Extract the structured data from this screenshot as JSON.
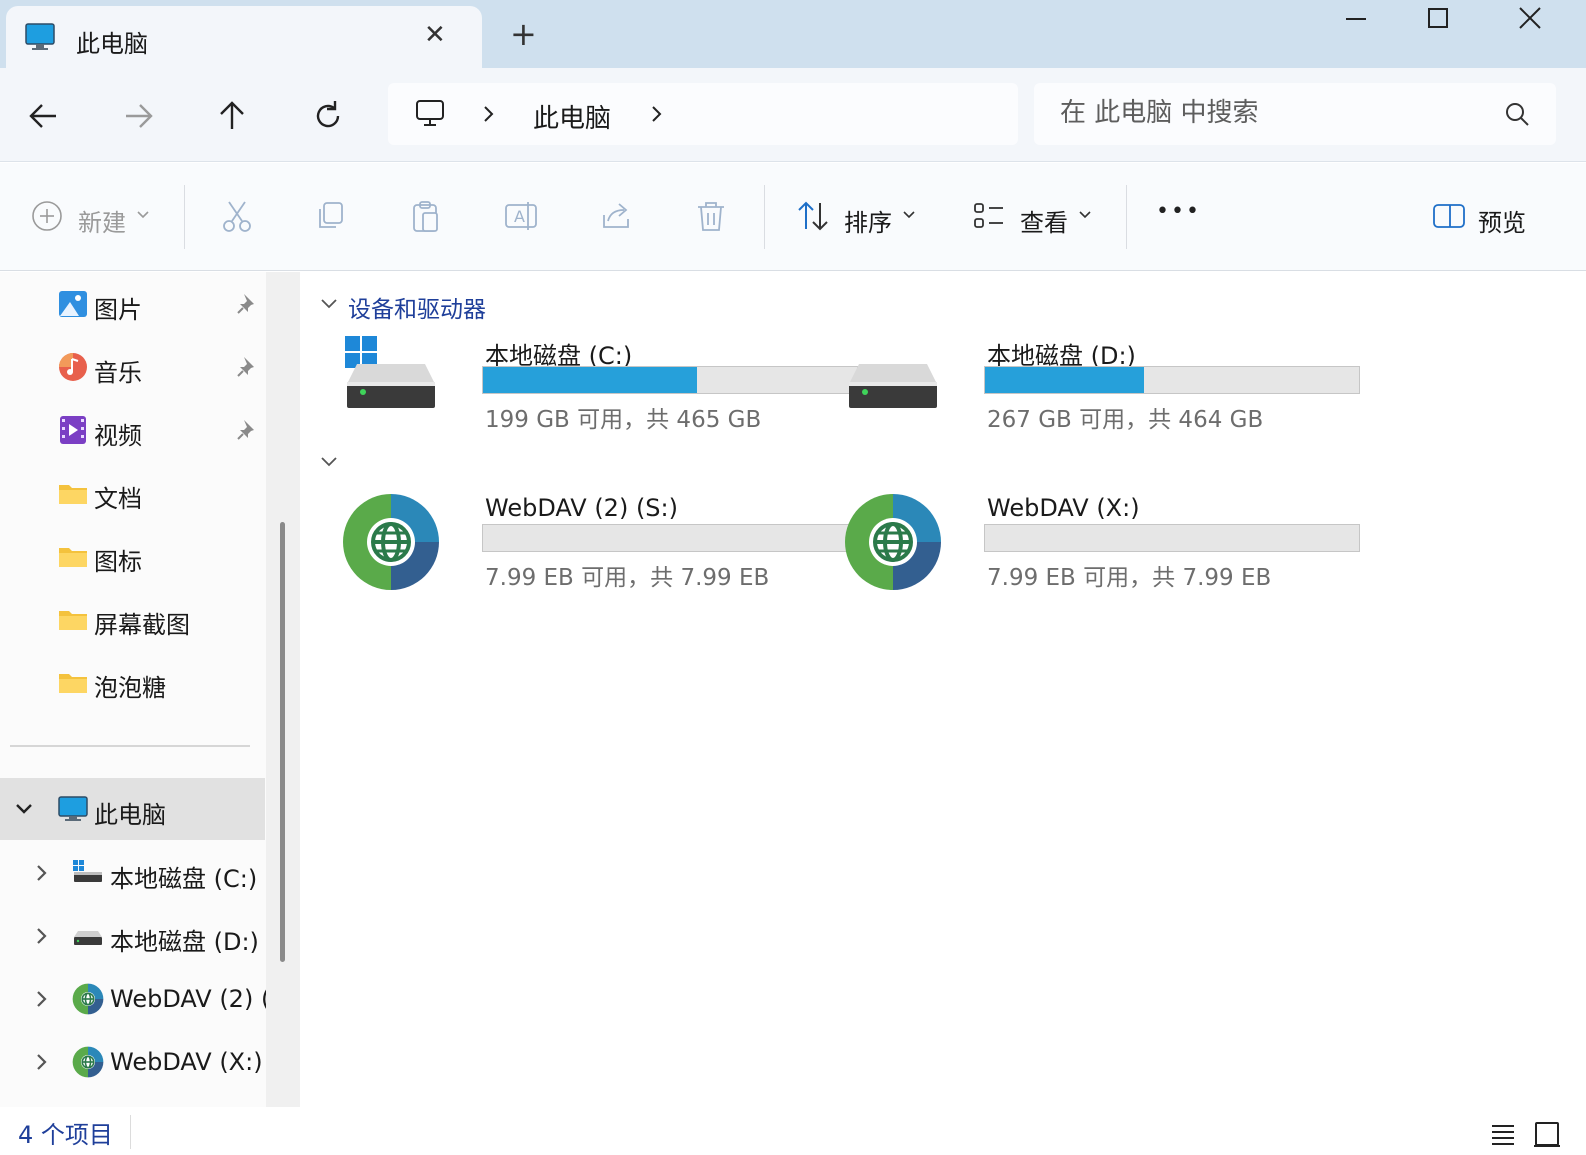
{
  "window": {
    "tab_title": "此电脑",
    "tab_close_glyph": "✕",
    "new_tab_glyph": "+"
  },
  "nav": {
    "breadcrumb": [
      "此电脑"
    ],
    "search_placeholder": "在 此电脑 中搜索"
  },
  "toolbar": {
    "new_label": "新建",
    "sort_label": "排序",
    "view_label": "查看",
    "more_label": "•••",
    "preview_label": "预览"
  },
  "sidebar": {
    "quick_access": [
      {
        "label": "图片",
        "icon": "pictures-icon",
        "pinned": true
      },
      {
        "label": "音乐",
        "icon": "music-icon",
        "pinned": true
      },
      {
        "label": "视频",
        "icon": "videos-icon",
        "pinned": true
      },
      {
        "label": "文档",
        "icon": "folder-icon",
        "pinned": false
      },
      {
        "label": "图标",
        "icon": "folder-icon",
        "pinned": false
      },
      {
        "label": "屏幕截图",
        "icon": "folder-icon",
        "pinned": false
      },
      {
        "label": "泡泡糖",
        "icon": "folder-icon",
        "pinned": false
      }
    ],
    "this_pc": {
      "label": "此电脑",
      "expanded": true,
      "selected": true
    },
    "drives": [
      {
        "label": "本地磁盘 (C:)",
        "icon": "windows-drive-icon"
      },
      {
        "label": "本地磁盘 (D:)",
        "icon": "drive-icon"
      },
      {
        "label": "WebDAV (2) (",
        "icon": "network-globe-icon"
      },
      {
        "label": "WebDAV (X:)",
        "icon": "network-globe-icon"
      }
    ]
  },
  "content": {
    "group_devices_title": "设备和驱动器",
    "group_network_title": "",
    "drives": [
      {
        "name": "本地磁盘 (C:)",
        "size_text": "199 GB 可用，共 465 GB",
        "used_fraction": 0.572,
        "icon": "windows-drive-icon"
      },
      {
        "name": "本地磁盘 (D:)",
        "size_text": "267 GB 可用，共 464 GB",
        "used_fraction": 0.424,
        "icon": "drive-icon"
      },
      {
        "name": "WebDAV (2) (S:)",
        "size_text": "7.99 EB 可用，共 7.99 EB",
        "used_fraction": 0.0,
        "icon": "network-globe-icon"
      },
      {
        "name": "WebDAV (X:)",
        "size_text": "7.99 EB 可用，共 7.99 EB",
        "used_fraction": 0.0,
        "icon": "network-globe-icon"
      }
    ]
  },
  "status": {
    "item_count": "4 个项目"
  },
  "colors": {
    "accent": "#26a0da",
    "group_title": "#1f3f9a",
    "titlebar": "#cfe0ee"
  }
}
